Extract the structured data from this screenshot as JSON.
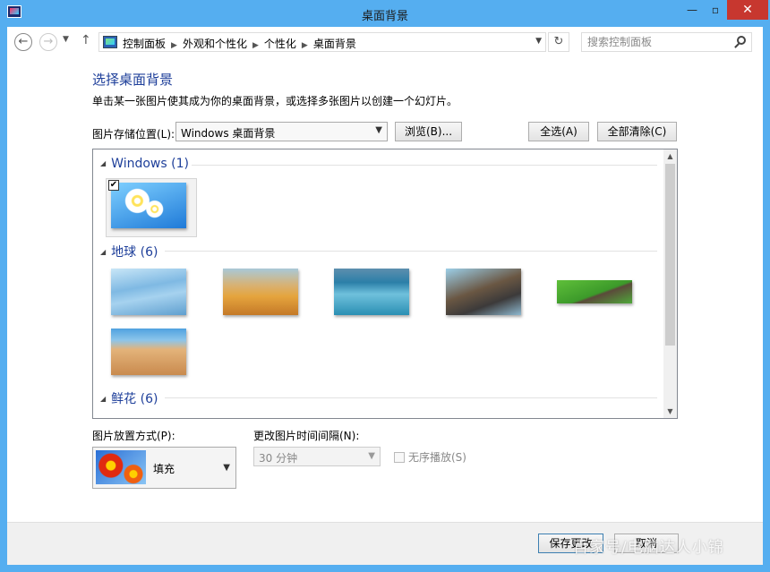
{
  "window": {
    "title": "桌面背景"
  },
  "address_bar": {
    "breadcrumbs": [
      "控制面板",
      "外观和个性化",
      "个性化",
      "桌面背景"
    ],
    "search_placeholder": "搜索控制面板"
  },
  "main": {
    "heading": "选择桌面背景",
    "subheading": "单击某一张图片使其成为你的桌面背景，或选择多张图片以创建一个幻灯片。",
    "location_label": "图片存储位置(L):",
    "location_value": "Windows 桌面背景",
    "browse_label": "浏览(B)...",
    "select_all_label": "全选(A)",
    "clear_all_label": "全部清除(C)"
  },
  "gallery": {
    "groups": [
      {
        "name": "Windows (1)",
        "count": 1
      },
      {
        "name": "地球 (6)",
        "count": 6
      },
      {
        "name": "鲜花 (6)",
        "count": 6
      }
    ],
    "selected_checkmark": "✔"
  },
  "options": {
    "position_label": "图片放置方式(P):",
    "position_value": "填充",
    "interval_label": "更改图片时间间隔(N):",
    "interval_value": "30 分钟",
    "shuffle_label": "无序播放(S)"
  },
  "footer": {
    "save_label": "保存更改",
    "cancel_label": "取消"
  },
  "watermark": "百家号/电脑达人小锦"
}
